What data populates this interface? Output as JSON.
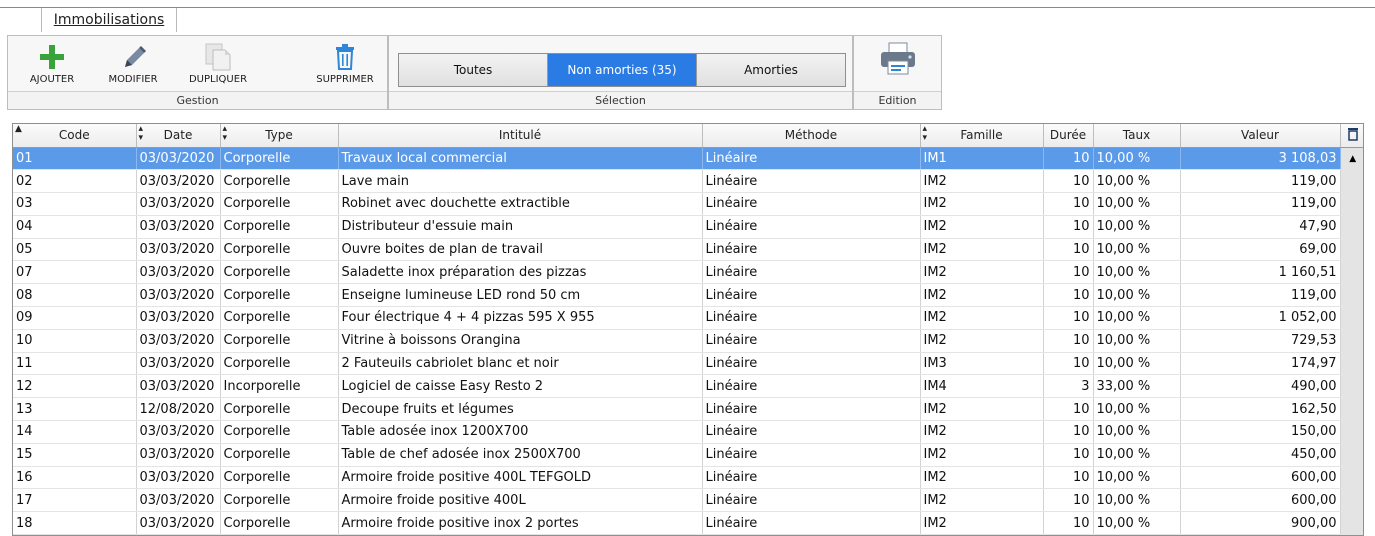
{
  "tab": {
    "label": "Immobilisations"
  },
  "toolbar": {
    "gestion": {
      "caption": "Gestion",
      "add_label": "AJOUTER",
      "edit_label": "MODIFIER",
      "duplicate_label": "DUPLIQUER",
      "delete_label": "SUPPRIMER"
    },
    "selection": {
      "caption": "Sélection",
      "options": [
        "Toutes",
        "Non amorties (35)",
        "Amorties"
      ],
      "active_index": 1
    },
    "edition": {
      "caption": "Edition",
      "print_icon": "printer-icon"
    }
  },
  "grid": {
    "columns": [
      "Code",
      "Date",
      "Type",
      "Intitulé",
      "Méthode",
      "Famille",
      "Durée",
      "Taux",
      "Valeur"
    ],
    "selected_row": 0,
    "rows": [
      [
        "01",
        "03/03/2020",
        "Corporelle",
        "Travaux local commercial",
        "Linéaire",
        "IM1",
        "10",
        "10,00 %",
        "3 108,03"
      ],
      [
        "02",
        "03/03/2020",
        "Corporelle",
        "Lave main",
        "Linéaire",
        "IM2",
        "10",
        "10,00 %",
        "119,00"
      ],
      [
        "03",
        "03/03/2020",
        "Corporelle",
        "Robinet avec douchette extractible",
        "Linéaire",
        "IM2",
        "10",
        "10,00 %",
        "119,00"
      ],
      [
        "04",
        "03/03/2020",
        "Corporelle",
        "Distributeur d'essuie main",
        "Linéaire",
        "IM2",
        "10",
        "10,00 %",
        "47,90"
      ],
      [
        "05",
        "03/03/2020",
        "Corporelle",
        "Ouvre boites de plan de travail",
        "Linéaire",
        "IM2",
        "10",
        "10,00 %",
        "69,00"
      ],
      [
        "07",
        "03/03/2020",
        "Corporelle",
        "Saladette inox préparation des pizzas",
        "Linéaire",
        "IM2",
        "10",
        "10,00 %",
        "1 160,51"
      ],
      [
        "08",
        "03/03/2020",
        "Corporelle",
        "Enseigne lumineuse LED rond 50 cm",
        "Linéaire",
        "IM2",
        "10",
        "10,00 %",
        "119,00"
      ],
      [
        "09",
        "03/03/2020",
        "Corporelle",
        "Four électrique 4 + 4 pizzas 595 X 955",
        "Linéaire",
        "IM2",
        "10",
        "10,00 %",
        "1 052,00"
      ],
      [
        "10",
        "03/03/2020",
        "Corporelle",
        "Vitrine à boissons Orangina",
        "Linéaire",
        "IM2",
        "10",
        "10,00 %",
        "729,53"
      ],
      [
        "11",
        "03/03/2020",
        "Corporelle",
        "2 Fauteuils cabriolet blanc et noir",
        "Linéaire",
        "IM3",
        "10",
        "10,00 %",
        "174,97"
      ],
      [
        "12",
        "03/03/2020",
        "Incorporelle",
        "Logiciel de caisse Easy Resto 2",
        "Linéaire",
        "IM4",
        "3",
        "33,00 %",
        "490,00"
      ],
      [
        "13",
        "12/08/2020",
        "Corporelle",
        "Decoupe fruits et légumes",
        "Linéaire",
        "IM2",
        "10",
        "10,00 %",
        "162,50"
      ],
      [
        "14",
        "03/03/2020",
        "Corporelle",
        "Table adosée inox 1200X700",
        "Linéaire",
        "IM2",
        "10",
        "10,00 %",
        "150,00"
      ],
      [
        "15",
        "03/03/2020",
        "Corporelle",
        "Table de chef adosée inox 2500X700",
        "Linéaire",
        "IM2",
        "10",
        "10,00 %",
        "450,00"
      ],
      [
        "16",
        "03/03/2020",
        "Corporelle",
        "Armoire froide positive 400L TEFGOLD",
        "Linéaire",
        "IM2",
        "10",
        "10,00 %",
        "600,00"
      ],
      [
        "17",
        "03/03/2020",
        "Corporelle",
        "Armoire froide positive 400L",
        "Linéaire",
        "IM2",
        "10",
        "10,00 %",
        "600,00"
      ],
      [
        "18",
        "03/03/2020",
        "Corporelle",
        "Armoire froide positive inox 2 portes",
        "Linéaire",
        "IM2",
        "10",
        "10,00 %",
        "900,00"
      ]
    ]
  }
}
